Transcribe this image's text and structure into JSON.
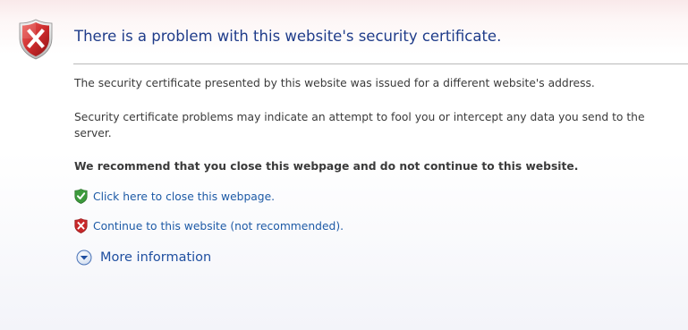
{
  "error": {
    "title": "There is a problem with this website's security certificate.",
    "paragraphs": [
      "The security certificate presented by this website was issued for a different website's address.",
      "Security certificate problems may indicate an attempt to fool you or intercept any data you send to the server."
    ],
    "recommendation": "We recommend that you close this webpage and do not continue to this website.",
    "actions": [
      {
        "label": "Click here to close this webpage.",
        "icon": "green-shield-check-icon"
      },
      {
        "label": "Continue to this website (not recommended).",
        "icon": "red-shield-x-icon"
      }
    ],
    "more_info": {
      "label": "More information",
      "icon": "chevron-down-circle-icon"
    }
  },
  "colors": {
    "title": "#1f3c8a",
    "link": "#1d5aa6",
    "body_text": "#3a3a3a",
    "error_red": "#c8282a",
    "safe_green": "#3c9a3c"
  }
}
